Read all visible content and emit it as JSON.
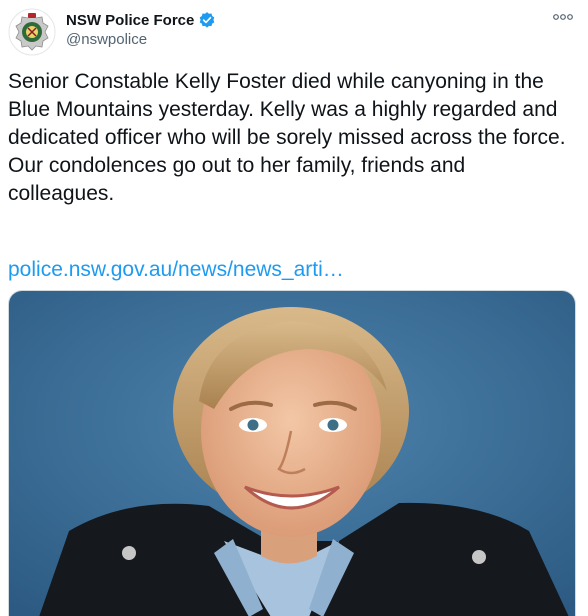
{
  "tweet": {
    "author_name": "NSW Police Force",
    "author_handle": "@nswpolice",
    "verified": true,
    "text": "Senior Constable Kelly Foster died while canyoning in the Blue Mountains yesterday. Kelly was a highly regarded and dedicated officer who will be sorely missed across the force. Our condolences go out to her family, friends and colleagues.",
    "link_text": "police.nsw.gov.au/news/news_arti…"
  },
  "icons": {
    "avatar": "nsw-police-badge-icon",
    "verified": "verified-badge-icon",
    "more": "more-options-icon"
  },
  "colors": {
    "text": "#0f1419",
    "secondary_text": "#536471",
    "link": "#1d9bf0",
    "verified": "#1d9bf0",
    "photo_background": "#3b6e97"
  }
}
